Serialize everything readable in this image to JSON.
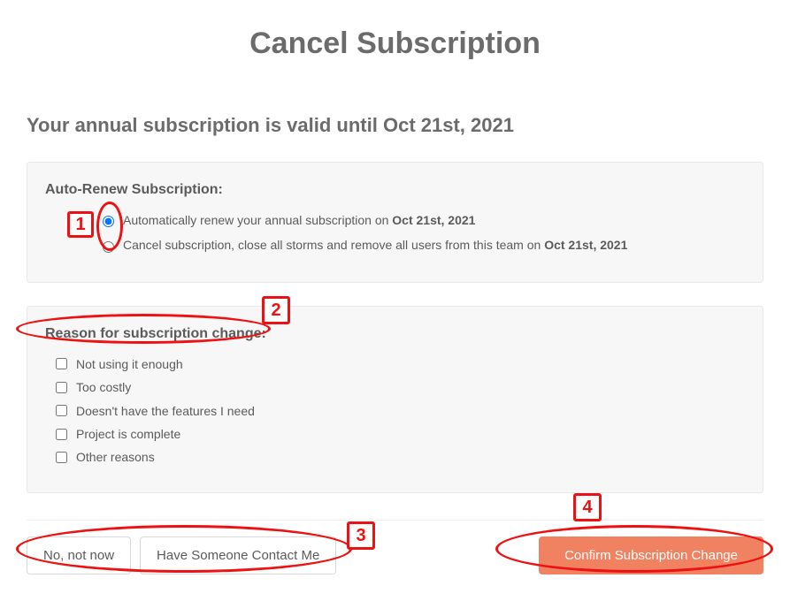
{
  "header": {
    "title": "Cancel Subscription"
  },
  "subhead": {
    "text_prefix": "Your annual subscription is valid until ",
    "date": "Oct 21st, 2021"
  },
  "autorenew_panel": {
    "title": "Auto-Renew Subscription:",
    "options": [
      {
        "text_pre": "Automatically renew your annual subscription on ",
        "bold": "Oct 21st, 2021",
        "checked": true
      },
      {
        "text_pre": "Cancel subscription, close all storms and remove all users from this team on ",
        "bold": "Oct 21st, 2021",
        "checked": false
      }
    ]
  },
  "reason_panel": {
    "title": "Reason for subscription change:",
    "options": [
      {
        "label": "Not using it enough"
      },
      {
        "label": "Too costly"
      },
      {
        "label": "Doesn't have the features I need"
      },
      {
        "label": "Project is complete"
      },
      {
        "label": "Other reasons"
      }
    ]
  },
  "actions": {
    "no_label": "No, not now",
    "contact_label": "Have Someone Contact Me",
    "confirm_label": "Confirm Subscription Change"
  },
  "annotations": {
    "n1": "1",
    "n2": "2",
    "n3": "3",
    "n4": "4"
  }
}
